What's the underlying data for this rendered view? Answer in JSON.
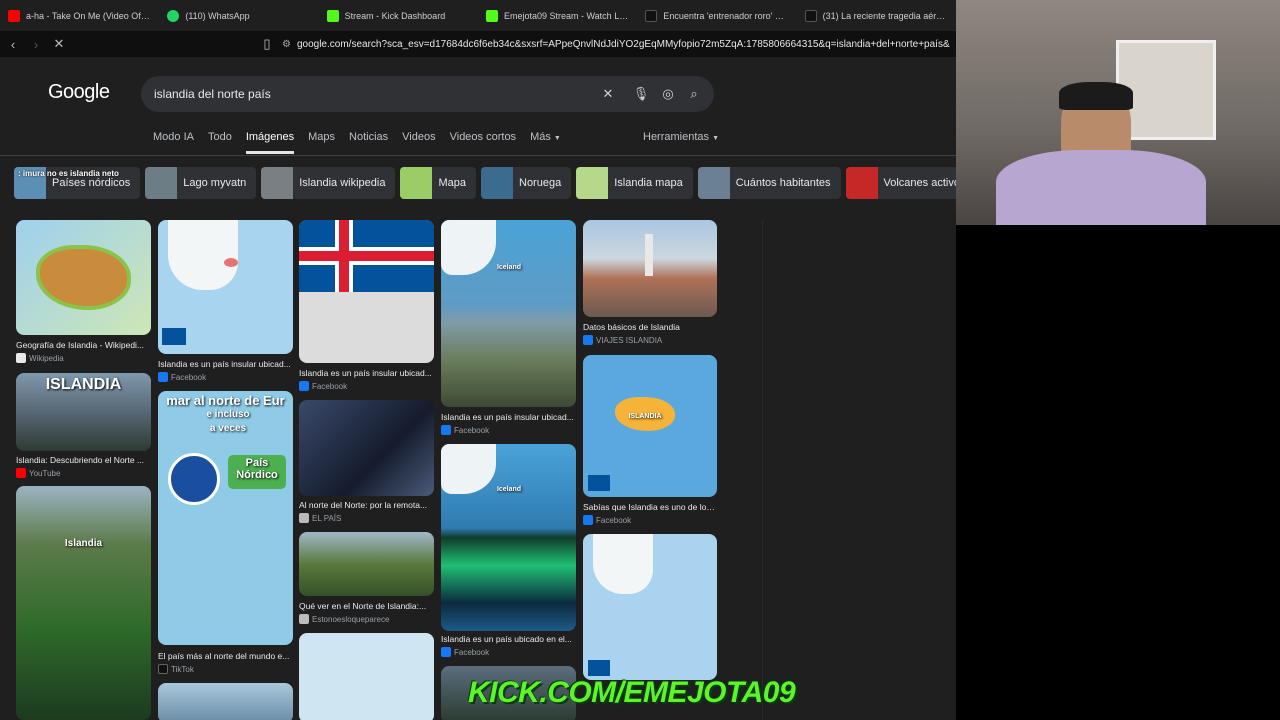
{
  "browser": {
    "tabs": [
      {
        "title": "a-ha - Take On Me (Video Oficial) -",
        "color": "#ff0000"
      },
      {
        "title": "(110) WhatsApp",
        "color": "#25d366"
      },
      {
        "title": "Stream - Kick Dashboard",
        "color": "#53fc18"
      },
      {
        "title": "Emejota09 Stream - Watch Live",
        "color": "#53fc18"
      },
      {
        "title": "Encuentra 'entrenador roro' en TikT",
        "color": "#111111"
      },
      {
        "title": "(31) La reciente tragedia aérea en",
        "color": "#111111"
      }
    ],
    "url": "google.com/search?sca_esv=d17684dc6f6eb34c&sxsrf=APpeQnvlNdJdiYO2gEqMMyfopio72m5ZqA:1785806664315&q=islandia+del+norte+país&udm..."
  },
  "google": {
    "logo": "Google",
    "query": "islandia del norte país",
    "nav_tabs": [
      "Modo IA",
      "Todo",
      "Imágenes",
      "Maps",
      "Noticias",
      "Videos",
      "Videos cortos",
      "Más"
    ],
    "active_tab": "Imágenes",
    "tools_label": "Herramientas",
    "chips": [
      {
        "label": "Países nórdicos",
        "color": "#5b8fb3"
      },
      {
        "label": "Lago myvatn",
        "color": "#6d7d86"
      },
      {
        "label": "Islandia wikipedia",
        "color": "#7a7f84"
      },
      {
        "label": "Mapa",
        "color": "#9ccc65"
      },
      {
        "label": "Noruega",
        "color": "#3b6b8f"
      },
      {
        "label": "Islandia mapa",
        "color": "#b6d88a"
      },
      {
        "label": "Cuántos habitantes",
        "color": "#6b7f95"
      },
      {
        "label": "Volcanes activos",
        "color": "#c62828"
      }
    ],
    "chat_overlay": ": imura no es islandia neto",
    "results": [
      {
        "caption": "Geografía de Islandia - Wikipedi...",
        "source": "Wikipedia",
        "src_color": "#e8e8e8"
      },
      {
        "caption": "Islandia: Descubriendo el Norte ...",
        "source": "YouTube",
        "src_color": "#ff0000"
      },
      {
        "caption": "",
        "source": "",
        "src_color": "#000"
      },
      {
        "caption": "Islandia es un país insular ubicad...",
        "source": "Facebook",
        "src_color": "#1877f2"
      },
      {
        "caption": "El país más al norte del mundo e...",
        "source": "TikTok",
        "src_color": "#111"
      },
      {
        "caption": "Islandia es un país insular ubicad...",
        "source": "Facebook",
        "src_color": "#1877f2"
      },
      {
        "caption": "Al norte del Norte: por la remota...",
        "source": "EL PAÍS",
        "src_color": "#bbb"
      },
      {
        "caption": "Qué ver en el Norte de Islandia:...",
        "source": "Estonoesloqueparece",
        "src_color": "#bbb"
      },
      {
        "caption": "Islandia es un país insular ubicad...",
        "source": "Facebook",
        "src_color": "#1877f2"
      },
      {
        "caption": "Islandia es un país ubicado en el...",
        "source": "Facebook",
        "src_color": "#1877f2"
      },
      {
        "caption": "Datos básicos de Islandia",
        "source": "VIAJES ISLANDIA",
        "src_color": "#1877f2"
      },
      {
        "caption": "Sabías que Islandia es uno de los...",
        "source": "Facebook",
        "src_color": "#1877f2"
      }
    ],
    "image_texts": {
      "islandia_title": "ISLANDIA",
      "islandia_label": "Islandia",
      "tiktok_line1": "mar al norte de Eur",
      "tiktok_line2": "e incluso",
      "tiktok_line3": "a veces",
      "pais_nordico": "País Nórdico",
      "iceland_label": "Iceland",
      "map_label": "ISLANDIA"
    }
  },
  "overlay": {
    "banner": "KICK.COM/EMEJOTA09"
  }
}
